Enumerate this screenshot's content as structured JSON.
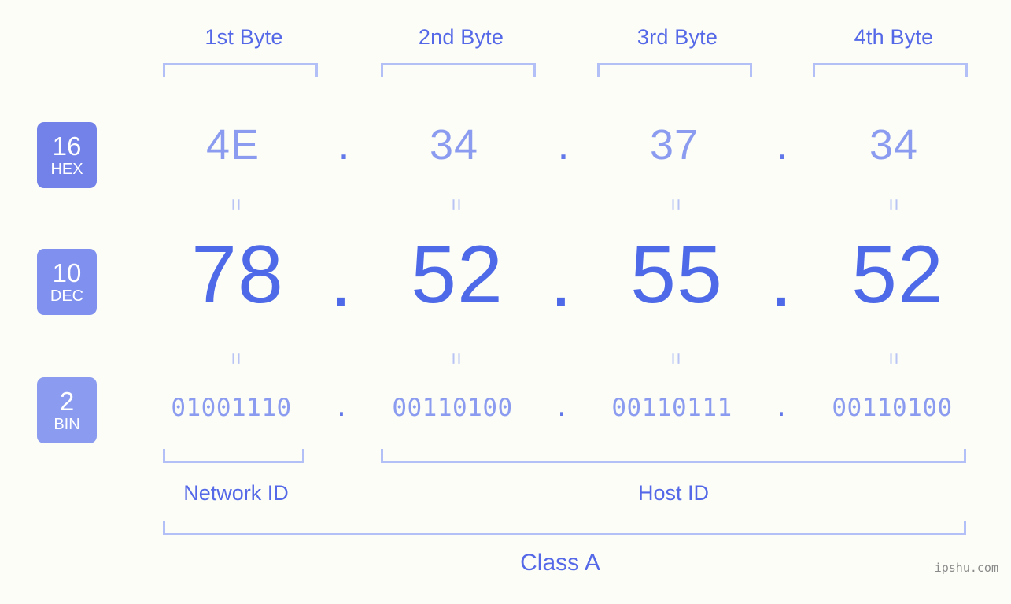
{
  "background_color": "#fbfdf6",
  "accent_color": "#4f6ae8",
  "accent_light": "#8b9cf0",
  "bracket_color": "#b3c0f8",
  "header": {
    "bytes": [
      {
        "label": "1st Byte"
      },
      {
        "label": "2nd Byte"
      },
      {
        "label": "3rd Byte"
      },
      {
        "label": "4th Byte"
      }
    ]
  },
  "rows": [
    {
      "badge_number": "16",
      "badge_name": "HEX",
      "badge_color": "#7282e8",
      "values": [
        "4E",
        "34",
        "37",
        "34"
      ],
      "separator": "."
    },
    {
      "badge_number": "10",
      "badge_name": "DEC",
      "badge_color": "#7f90ee",
      "values": [
        "78",
        "52",
        "55",
        "52"
      ],
      "separator": "."
    },
    {
      "badge_number": "2",
      "badge_name": "BIN",
      "badge_color": "#8b9cf0",
      "values": [
        "01001110",
        "00110100",
        "00110111",
        "00110100"
      ],
      "separator": "."
    }
  ],
  "equals_symbol": "=",
  "footer": {
    "network_id_label": "Network ID",
    "host_id_label": "Host ID",
    "class_label": "Class A"
  },
  "watermark": "ipshu.com"
}
